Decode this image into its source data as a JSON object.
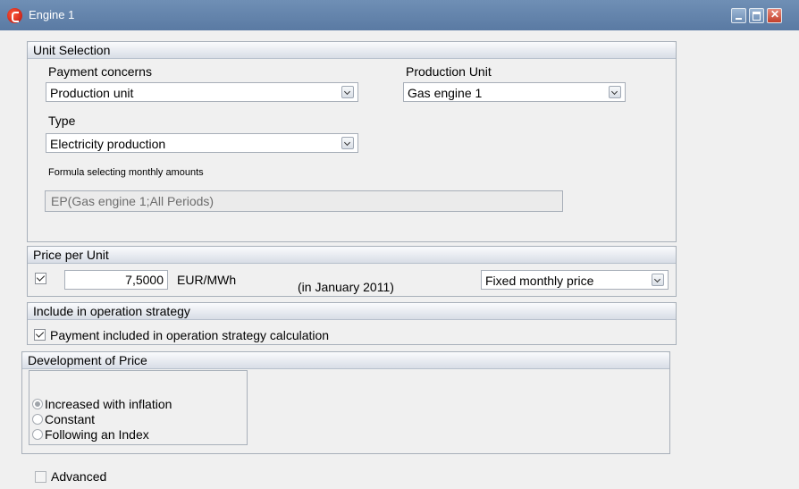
{
  "window": {
    "title": "Engine 1"
  },
  "unit_selection": {
    "header": "Unit Selection",
    "payment_concerns": {
      "label": "Payment concerns",
      "value": "Production unit"
    },
    "production_unit": {
      "label": "Production Unit",
      "value": "Gas engine 1"
    },
    "type": {
      "label": "Type",
      "value": "Electricity production"
    },
    "formula": {
      "label": "Formula selecting monthly amounts",
      "value": "EP(Gas engine 1;All Periods)"
    }
  },
  "price_per_unit": {
    "header": "Price per Unit",
    "checked": true,
    "value": "7,5000",
    "unit": "EUR/MWh",
    "period": "(in  January 2011)",
    "price_type": "Fixed monthly price"
  },
  "operation_strategy": {
    "header": "Include in operation strategy",
    "checkbox_label": "Payment included in operation strategy calculation",
    "checked": true
  },
  "development": {
    "header": "Development of Price",
    "options": [
      "Increased with inflation",
      "Constant",
      "Following an Index"
    ],
    "selected": "Increased with inflation"
  },
  "advanced": {
    "label": "Advanced",
    "checked": false
  }
}
